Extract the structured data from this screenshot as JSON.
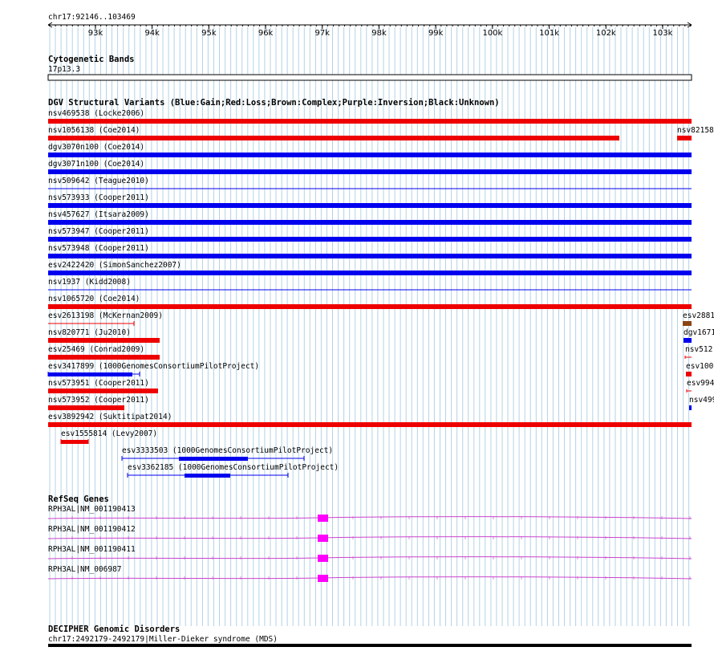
{
  "ruler": {
    "range_label": "chr17:92146..103469",
    "ticks": [
      "93k",
      "94k",
      "95k",
      "96k",
      "97k",
      "98k",
      "99k",
      "100k",
      "101k",
      "102k",
      "103k"
    ]
  },
  "colors": {
    "gain": "#0000ee",
    "loss": "#ee0000",
    "complex": "#8b4513",
    "gene": "#cc44cc",
    "exon": "#ff00ff",
    "grid": "#b4d2e6"
  },
  "tracks": {
    "cytoband": {
      "title": "Cytogenetic Bands",
      "band": "17p13.3"
    },
    "dgv": {
      "title": "DGV Structural Variants (Blue:Gain;Red:Loss;Brown:Complex;Purple:Inversion;Black:Unknown)",
      "features": [
        {
          "label": "nsv469538 (Locke2006)",
          "type": "loss",
          "thick": true
        },
        {
          "label": "nsv1056138 (Coe2014)",
          "type": "loss",
          "thick": true
        },
        {
          "label": "nsv82158",
          "type": "loss",
          "thick": true
        },
        {
          "label": "dgv3070n100 (Coe2014)",
          "type": "gain",
          "thick": true
        },
        {
          "label": "dgv3071n100 (Coe2014)",
          "type": "gain",
          "thick": true
        },
        {
          "label": "nsv509642 (Teague2010)",
          "type": "gain",
          "thick": false
        },
        {
          "label": "nsv573933 (Cooper2011)",
          "type": "gain",
          "thick": true
        },
        {
          "label": "nsv457627 (Itsara2009)",
          "type": "gain",
          "thick": true
        },
        {
          "label": "nsv573947 (Cooper2011)",
          "type": "gain",
          "thick": true
        },
        {
          "label": "nsv573948 (Cooper2011)",
          "type": "gain",
          "thick": true
        },
        {
          "label": "esv2422420 (SimonSanchez2007)",
          "type": "gain",
          "thick": true
        },
        {
          "label": "nsv1937 (Kidd2008)",
          "type": "gain",
          "thick": false
        },
        {
          "label": "nsv1065720 (Coe2014)",
          "type": "loss",
          "thick": true
        },
        {
          "label": "esv2613198 (McKernan2009)",
          "type": "loss",
          "thick": false
        },
        {
          "label": "esv2881",
          "type": "complex",
          "thick": true
        },
        {
          "label": "nsv820771 (Ju2010)",
          "type": "loss",
          "thick": true
        },
        {
          "label": "dgv1671",
          "type": "gain",
          "thick": true
        },
        {
          "label": "esv25469 (Conrad2009)",
          "type": "loss",
          "thick": true
        },
        {
          "label": "nsv512",
          "type": "loss",
          "thick": false
        },
        {
          "label": "esv3417899 (1000GenomesConsortiumPilotProject)",
          "type": "gain",
          "thick": true
        },
        {
          "label": "esv100",
          "type": "loss",
          "thick": true
        },
        {
          "label": "nsv573951 (Cooper2011)",
          "type": "loss",
          "thick": true
        },
        {
          "label": "esv994",
          "type": "loss",
          "thick": false
        },
        {
          "label": "nsv573952 (Cooper2011)",
          "type": "loss",
          "thick": true
        },
        {
          "label": "nsv499",
          "type": "gain",
          "thick": true
        },
        {
          "label": "esv3892942 (Suktitipat2014)",
          "type": "loss",
          "thick": true
        },
        {
          "label": "esv1555814 (Levy2007)",
          "type": "loss",
          "thick": true
        },
        {
          "label": "esv3333503 (1000GenomesConsortiumPilotProject)",
          "type": "gain",
          "thick": true
        },
        {
          "label": "esv3362185 (1000GenomesConsortiumPilotProject)",
          "type": "gain",
          "thick": true
        }
      ]
    },
    "refseq": {
      "title": "RefSeq Genes",
      "transcripts": [
        "RPH3AL|NM_001190413",
        "RPH3AL|NM_001190412",
        "RPH3AL|NM_001190411",
        "RPH3AL|NM_006987"
      ]
    },
    "decipher": {
      "title": "DECIPHER Genomic Disorders",
      "feature": "chr17:2492179-2492179|Miller-Dieker syndrome (MDS)"
    }
  }
}
